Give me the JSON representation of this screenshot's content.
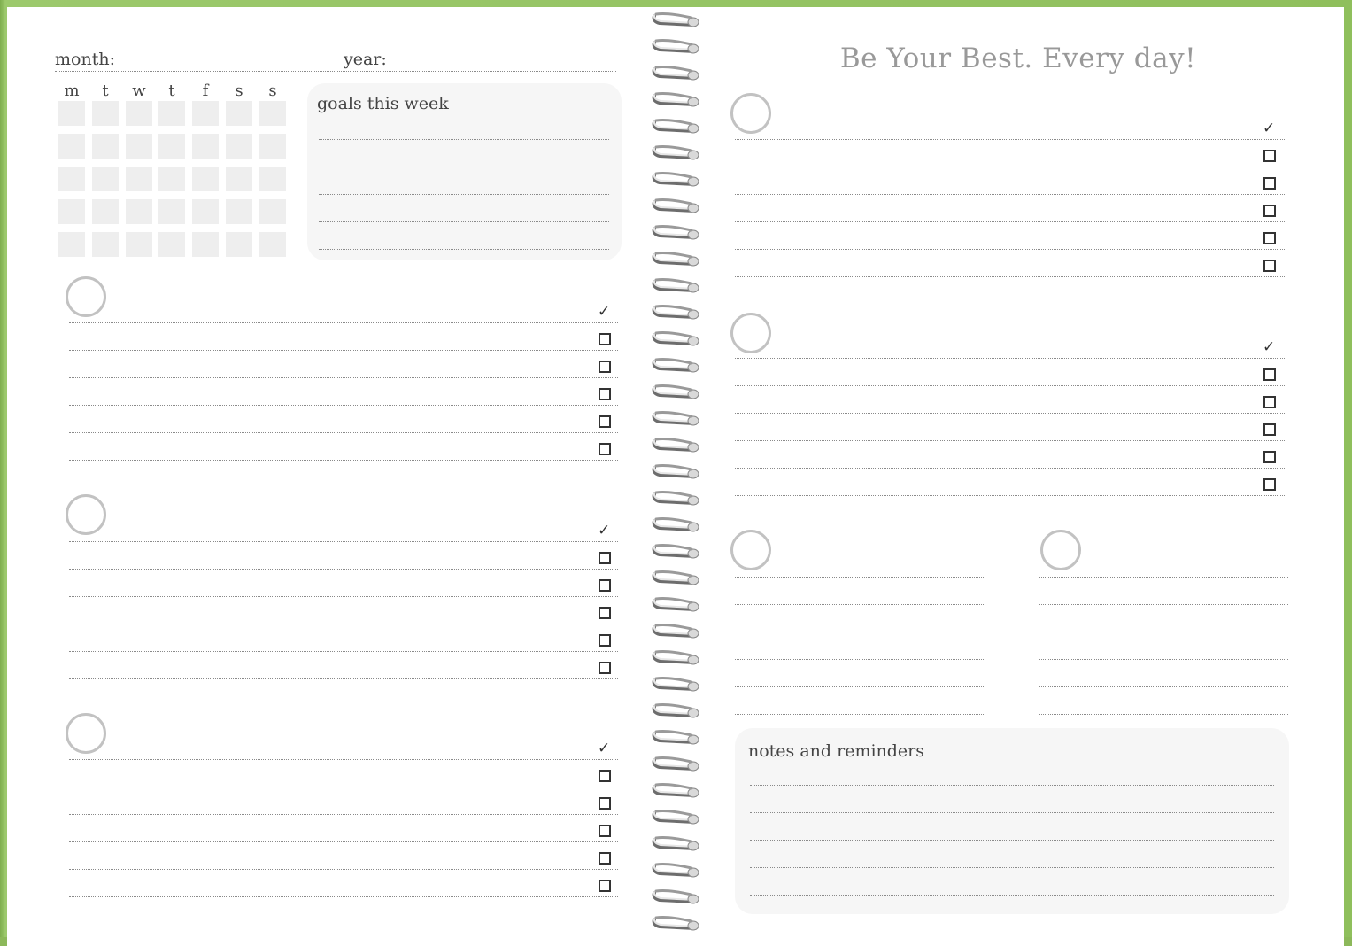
{
  "header": {
    "month_label": "month:",
    "year_label": "year:",
    "motto": "Be Your Best.  Every day!"
  },
  "calendar": {
    "day_headers": [
      "m",
      "t",
      "w",
      "t",
      "f",
      "s",
      "s"
    ],
    "rows": 5
  },
  "goals": {
    "title": "goals this week"
  },
  "notes": {
    "title": "notes and reminders"
  },
  "icons": {
    "check": "check-icon",
    "checkbox": "checkbox-icon",
    "circle": "circle-icon",
    "spiral": "spiral-ring-icon"
  },
  "colors": {
    "frame": "#8cb85a",
    "paper": "#ffffff",
    "panel": "#f6f6f6",
    "calendar_cell": "#eeeeee",
    "circle": "#c2c2c2",
    "motto": "#999999"
  }
}
